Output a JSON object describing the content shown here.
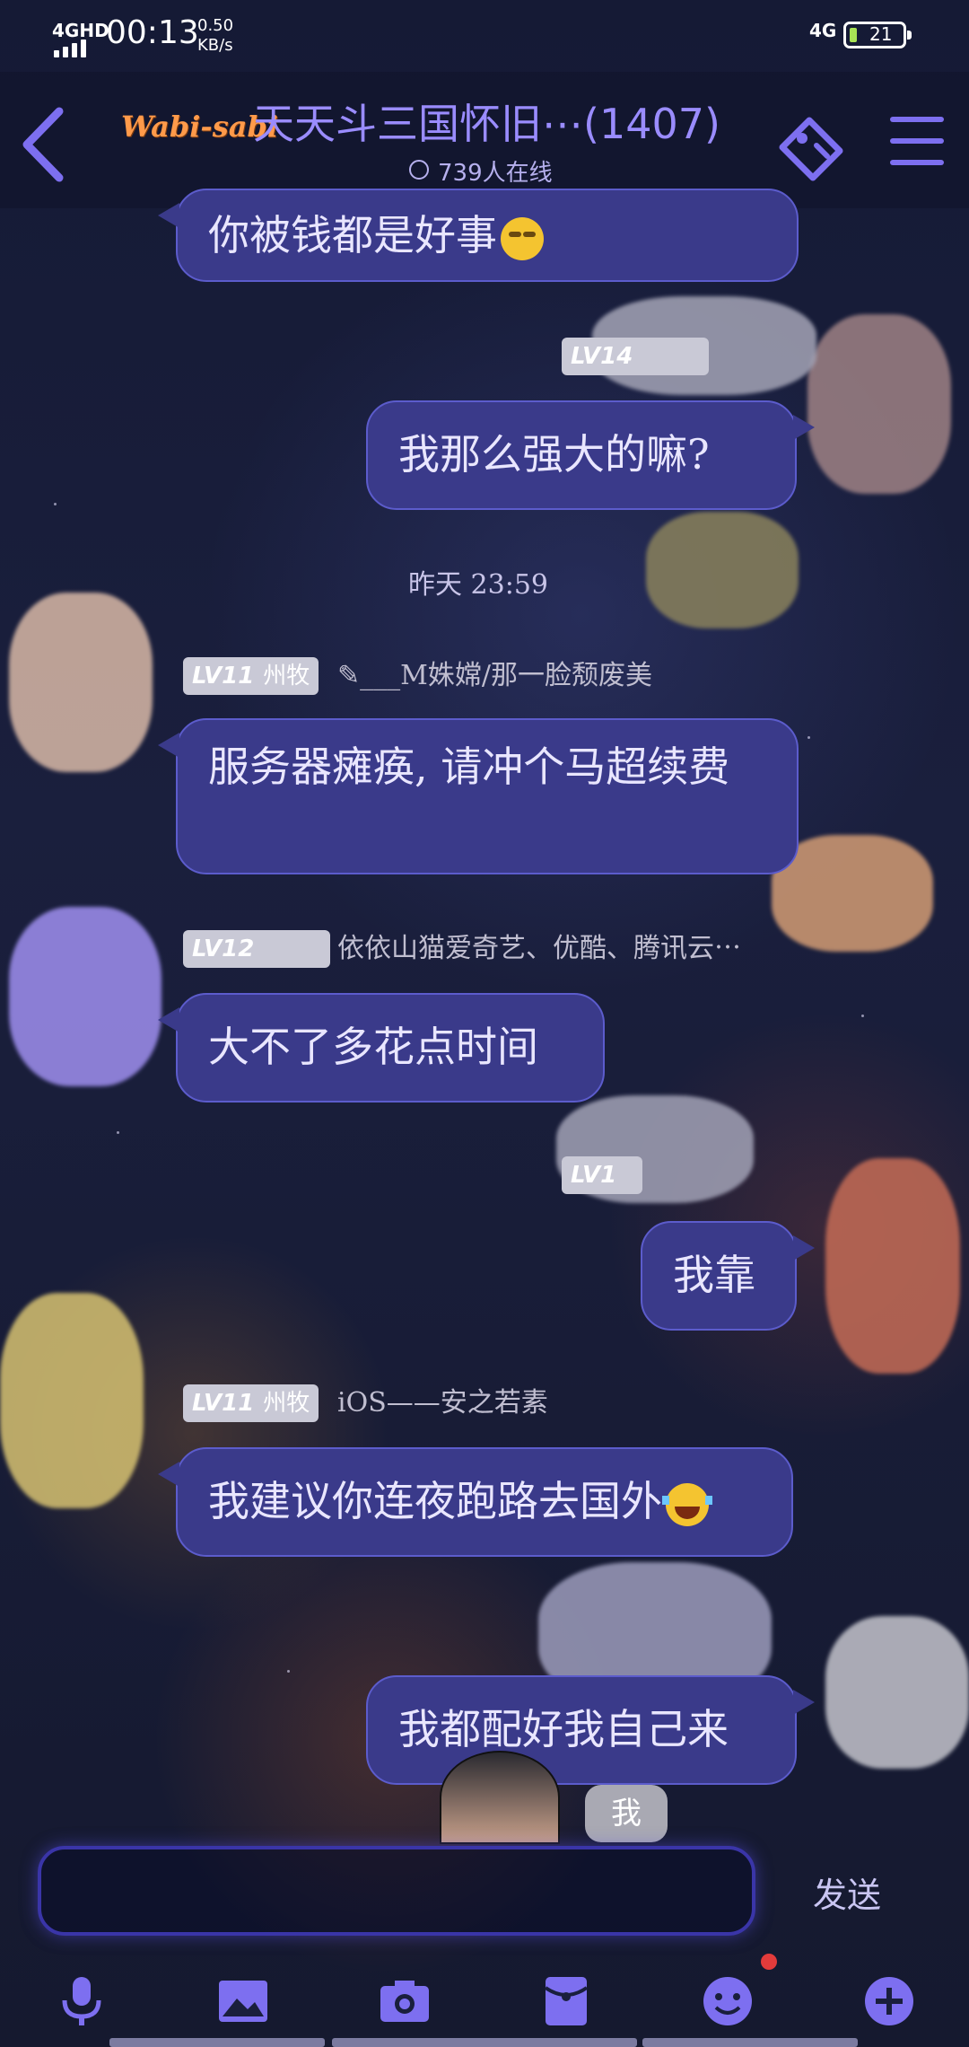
{
  "status_bar": {
    "network": "4GHD",
    "time": "00:13",
    "speed_value": "0.50",
    "speed_unit": "KB/s",
    "mobile_data": "4G",
    "battery": "21"
  },
  "header": {
    "brand": "Wabi-sabi",
    "title": "天天斗三国怀旧⋯(1407)",
    "online": "739人在线"
  },
  "messages": [
    {
      "side": "left",
      "text": "你被钱都是好事",
      "emoji": "smirk-emoji"
    },
    {
      "side": "right",
      "level": "LV14",
      "text": "我那么强大的嘛?"
    },
    {
      "type": "timestamp",
      "text": "昨天 23:59"
    },
    {
      "side": "left",
      "level": "LV11",
      "title": "州牧",
      "nick": "✎___M姝嫦/那一脸颓废美",
      "text": "服务器瘫痪, 请冲个马超续费"
    },
    {
      "side": "left",
      "level": "LV12",
      "nick": "依依山猫爱奇艺、优酷、腾讯云⋯",
      "text": "大不了多花点时间"
    },
    {
      "side": "right",
      "level": "LV1",
      "text": "我靠"
    },
    {
      "side": "left",
      "level": "LV11",
      "title": "州牧",
      "nick": "iOS——安之若素",
      "text": "我建议你连夜跑路去国外",
      "emoji": "laugh-emoji"
    },
    {
      "side": "right",
      "text": "我都配好我自己来"
    }
  ],
  "popup_bubble": "我",
  "composer": {
    "placeholder": "",
    "send_label": "发送"
  },
  "toolbar": [
    "microphone-icon",
    "image-icon",
    "camera-icon",
    "red-packet-icon",
    "emoji-icon",
    "plus-icon"
  ],
  "colors": {
    "accent": "#7d6ff0",
    "bubble": "#3a3a8a",
    "bubble_border": "#5c5ccc",
    "notification_dot": "#e33b3b"
  }
}
